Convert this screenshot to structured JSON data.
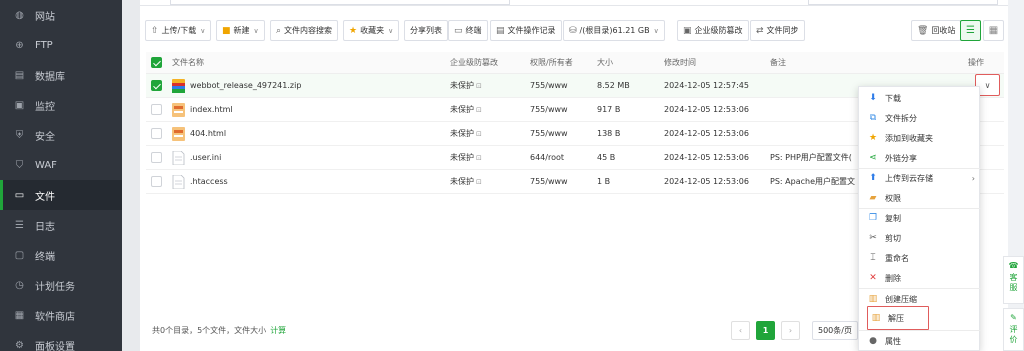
{
  "sidebar": {
    "items": [
      {
        "label": "网站",
        "icon": "globe-icon"
      },
      {
        "label": "FTP",
        "icon": "ftp-icon"
      },
      {
        "label": "数据库",
        "icon": "database-icon"
      },
      {
        "label": "监控",
        "icon": "monitor-icon"
      },
      {
        "label": "安全",
        "icon": "shield-icon"
      },
      {
        "label": "WAF",
        "icon": "waf-icon"
      },
      {
        "label": "文件",
        "icon": "folder-icon",
        "active": true
      },
      {
        "label": "日志",
        "icon": "log-icon"
      },
      {
        "label": "终端",
        "icon": "terminal-icon"
      },
      {
        "label": "计划任务",
        "icon": "clock-icon"
      },
      {
        "label": "软件商店",
        "icon": "store-icon"
      },
      {
        "label": "面板设置",
        "icon": "gear-icon"
      }
    ]
  },
  "toolbar": {
    "upload": "上传/下载",
    "new": "新建",
    "search_content": "文件内容搜索",
    "favorites": "收藏夹",
    "share_list": "分享列表",
    "terminal": "终端",
    "op_log": "文件操作记录",
    "disk": "/(根目录)61.21 GB",
    "tamper": "企业级防篡改",
    "sync": "文件同步",
    "recycle": "回收站"
  },
  "table": {
    "headers": {
      "name": "文件名称",
      "tamper": "企业级防篡改",
      "perm": "权限/所有者",
      "size": "大小",
      "mtime": "修改时间",
      "note": "备注",
      "ops": "操作"
    },
    "rows": [
      {
        "name": "webbot_release_497241.zip",
        "tamper": "未保护",
        "perm": "755/www",
        "size": "8.52 MB",
        "mtime": "2024-12-05 12:57:45",
        "note": "",
        "selected": true,
        "type": "zip"
      },
      {
        "name": "index.html",
        "tamper": "未保护",
        "perm": "755/www",
        "size": "917 B",
        "mtime": "2024-12-05 12:53:06",
        "note": "",
        "selected": false,
        "type": "html"
      },
      {
        "name": "404.html",
        "tamper": "未保护",
        "perm": "755/www",
        "size": "138 B",
        "mtime": "2024-12-05 12:53:06",
        "note": "",
        "selected": false,
        "type": "html"
      },
      {
        "name": ".user.ini",
        "tamper": "未保护",
        "perm": "644/root",
        "size": "45 B",
        "mtime": "2024-12-05 12:53:06",
        "note": "PS: PHP用户配置文件(",
        "selected": false,
        "type": "text"
      },
      {
        "name": ".htaccess",
        "tamper": "未保护",
        "perm": "755/www",
        "size": "1 B",
        "mtime": "2024-12-05 12:53:06",
        "note": "PS: Apache用户配置文",
        "selected": false,
        "type": "text"
      }
    ]
  },
  "context_menu": {
    "items": [
      {
        "label": "下载",
        "icon": "download-icon",
        "color": "#2f7ce8"
      },
      {
        "label": "文件拆分",
        "icon": "split-icon",
        "color": "#3a8ee6"
      },
      {
        "label": "添加到收藏夹",
        "icon": "star-icon",
        "color": "#f0a500"
      },
      {
        "label": "外链分享",
        "icon": "share-icon",
        "color": "#20a53a"
      },
      {
        "label": "上传到云存储",
        "icon": "cloud-upload-icon",
        "color": "#2f7ce8",
        "submenu": true
      },
      {
        "label": "权限",
        "icon": "key-icon",
        "color": "#e6a23c"
      },
      {
        "label": "复制",
        "icon": "copy-icon",
        "color": "#3a8ee6"
      },
      {
        "label": "剪切",
        "icon": "scissors-icon",
        "color": "#555555"
      },
      {
        "label": "重命名",
        "icon": "rename-icon",
        "color": "#555555"
      },
      {
        "label": "删除",
        "icon": "delete-icon",
        "color": "#e03c3c"
      },
      {
        "label": "创建压缩",
        "icon": "zip-icon",
        "color": "#e6a23c"
      },
      {
        "label": "解压",
        "icon": "unzip-icon",
        "color": "#e6a23c"
      },
      {
        "label": "属性",
        "icon": "info-icon",
        "color": "#666666"
      }
    ]
  },
  "footer": {
    "summary": "共0个目录，5个文件，文件大小",
    "calc": "计算",
    "page": "1",
    "page_size": "500条/页"
  },
  "float_tabs": {
    "service": "客服",
    "review": "评价"
  },
  "colors": {
    "accent": "#20a53a",
    "sidebar_bg": "#30353d",
    "highlight": "#e05c5c"
  }
}
